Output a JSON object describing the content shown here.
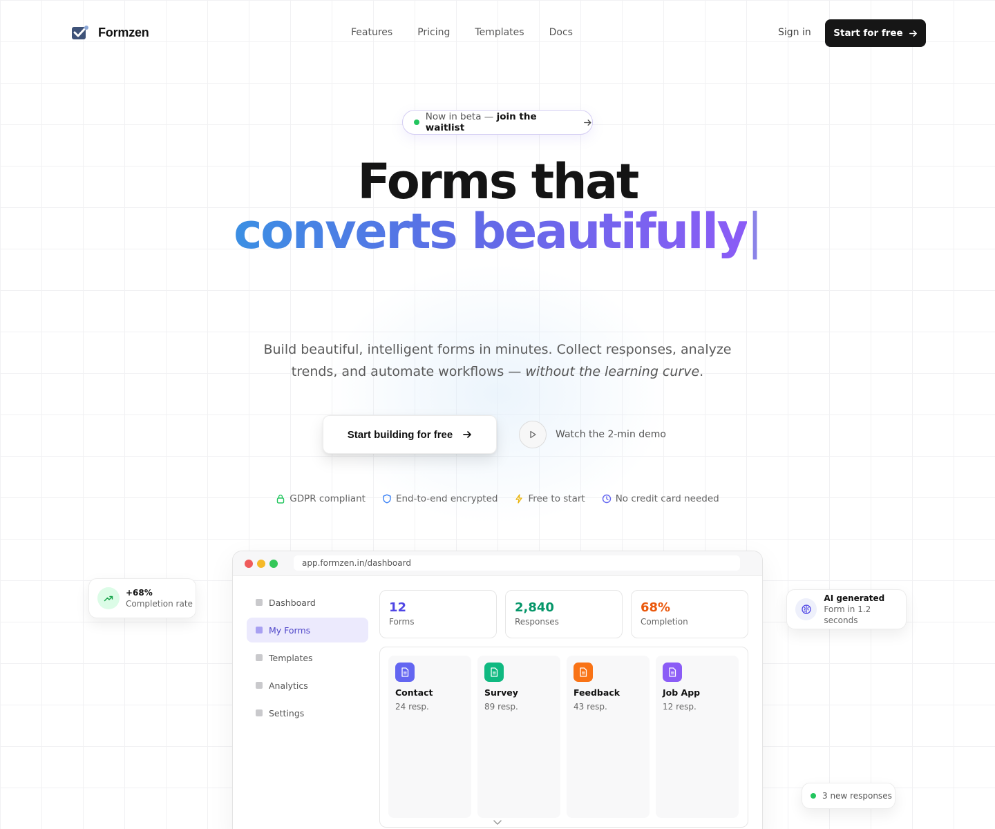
{
  "brand": {
    "name": "Formzen"
  },
  "nav": {
    "links": [
      "Features",
      "Pricing",
      "Templates",
      "Docs"
    ],
    "signin": "Sign in",
    "cta": "Start for free"
  },
  "hero": {
    "beta_prefix": "Now in beta —",
    "beta_link": "join the waitlist",
    "title_line1": "Forms that",
    "title_line2": "converts beautifully",
    "caret": "|",
    "subtitle": "Build beautiful, intelligent forms in minutes. Collect responses, analyze trends, and automate workflows — ",
    "subtitle_em": "without the learning curve",
    "subtitle_end": ".",
    "cta_primary": "Start building for free",
    "cta_demo": "Watch the 2-min demo"
  },
  "trust": [
    {
      "label": "GDPR compliant",
      "icon": "lock-icon",
      "color": "#22c55e"
    },
    {
      "label": "End-to-end encrypted",
      "icon": "shield-icon",
      "color": "#3b82f6"
    },
    {
      "label": "Free to start",
      "icon": "lightning-icon",
      "color": "#eab308"
    },
    {
      "label": "No credit card needed",
      "icon": "clock-icon",
      "color": "#6366f1"
    }
  ],
  "float_left": {
    "value": "+68%",
    "label": "Completion rate",
    "icon": "trending-up-icon"
  },
  "float_right": {
    "title": "AI generated",
    "label": "Form in 1.2 seconds",
    "icon": "brain-icon"
  },
  "float_badge": {
    "label": "3 new responses"
  },
  "browser": {
    "url": "app.formzen.in/dashboard",
    "sidebar": [
      "Dashboard",
      "My Forms",
      "Templates",
      "Analytics",
      "Settings"
    ],
    "active_sidebar": "My Forms",
    "stats": [
      {
        "value": "12",
        "label": "Forms",
        "color": "#4f46e5"
      },
      {
        "value": "2,840",
        "label": "Responses",
        "color": "#059669"
      },
      {
        "value": "68%",
        "label": "Completion",
        "color": "#ea580c"
      }
    ],
    "forms": [
      {
        "name": "Contact",
        "resp": "24 resp.",
        "color": "#6366f1"
      },
      {
        "name": "Survey",
        "resp": "89 resp.",
        "color": "#10b981"
      },
      {
        "name": "Feedback",
        "resp": "43 resp.",
        "color": "#f97316"
      },
      {
        "name": "Job App",
        "resp": "12 resp.",
        "color": "#8b5cf6"
      }
    ]
  }
}
